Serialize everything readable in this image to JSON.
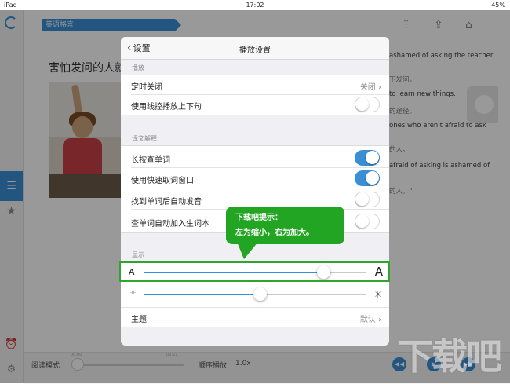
{
  "status_bar": {
    "device": "iPad",
    "time": "17:02",
    "battery": "45%"
  },
  "app": {
    "tag_label": "英语格言",
    "lesson_title": "害怕发问的人就",
    "reading_lines": [
      "ashamed of asking the teacher",
      "下发问。",
      "to learn new things.",
      "的途径。",
      "ones who aren't afraid to ask",
      "的人。",
      "afraid of asking is ashamed of",
      "的人。\""
    ]
  },
  "bottom_bar": {
    "mode_label": "阅读模式",
    "order_label": "顺序播放",
    "speed": "1.0x",
    "progress": 0
  },
  "dialog": {
    "back_label": "设置",
    "title": "播放设置",
    "section_play": "播放",
    "row_timer": "定时关闭",
    "row_timer_value": "关闭",
    "row_remote": "使用线控播放上下句",
    "section_translate": "译文解释",
    "row_longpress": "长按查单词",
    "row_quicklookup": "使用快速取词窗口",
    "row_autopronounce": "找到单词后自动发音",
    "row_addvocab": "查单词自动加入生词本",
    "section_display": "显示",
    "font_small": "A",
    "font_big": "A",
    "font_size_level": 0.81,
    "brightness_level": 0.52,
    "row_theme": "主题",
    "row_theme_value": "默认"
  },
  "toggles": {
    "remote": false,
    "longpress": true,
    "quicklookup": true,
    "autopronounce": false,
    "addvocab": false
  },
  "callout": {
    "line1": "下载吧提示：",
    "line2": "左为缩小，右为加大。"
  },
  "watermark": "下载吧",
  "colors": {
    "accent": "#3a8ed6",
    "callout": "#22a522"
  }
}
